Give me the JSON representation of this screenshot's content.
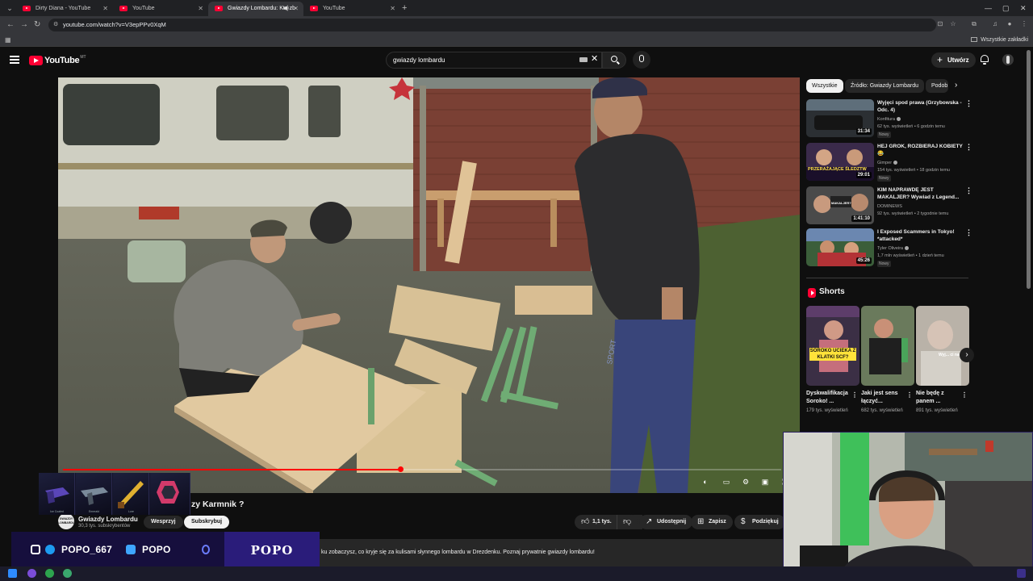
{
  "browser": {
    "tabs": [
      {
        "title": "Dirty Diana - YouTube",
        "active": false
      },
      {
        "title": "YouTube",
        "active": false
      },
      {
        "title": "Gwiazdy Lombardu: Kto zb",
        "active": true
      },
      {
        "title": "YouTube",
        "active": false
      }
    ],
    "url": "youtube.com/watch?v=V3epPPv0XqM",
    "all_bookmarks_label": "Wszystkie zakładki"
  },
  "youtube": {
    "logo_text": "YouTube",
    "country_code": "MT",
    "search_value": "gwiazdy lombardu",
    "create_label": "Utwórz"
  },
  "video": {
    "progress": 0.47,
    "title_visible": "zy Karmnik ?",
    "channel": {
      "name": "Gwiazdy Lombardu",
      "subscribers": "30,3 tys. subskrybentów",
      "avatar_text": "GWIAZDY LOMBARDU"
    },
    "join_label": "Wesprzyj",
    "subscribe_label": "Subskrybuj",
    "likes": "1,1 tys.",
    "share_label": "Udostępnij",
    "save_label": "Zapisz",
    "thanks_label": "Podziękuj",
    "description": "ku zobaczysz, co kryje się za kulisami słynnego lombardu w Drezdenku. Poznaj prywatnie gwiazdy lombardu!"
  },
  "sidebar": {
    "chips": [
      "Wszystkie",
      "Źródło: Gwiazdy Lombardu",
      "Podob"
    ],
    "recommendations": [
      {
        "title": "Wyjęci spod prawa (Grzybowska - Odc. 4)",
        "channel": "Konfitura",
        "meta": "62 tys. wyświetleń • 6 godzin temu",
        "badge": "Nowy",
        "duration": "31:34",
        "thumb_text": ""
      },
      {
        "title": "HEJ GROK, ROZBIERAJ KOBIETY 😂",
        "channel": "Gimper",
        "meta": "154 tys. wyświetleń • 18 godzin temu",
        "badge": "Nowy",
        "duration": "29:01",
        "thumb_text": "PRZERAŻAJĄCE ŚLEDZTW"
      },
      {
        "title": "KIM NAPRAWDĘ JEST MAKALJER? Wywiad z Legend...",
        "channel": "DOMINEWS",
        "meta": "92 tys. wyświetleń • 2 tygodnie temu",
        "badge": "",
        "duration": "1:41:10",
        "thumb_text": "MAKALJER?"
      },
      {
        "title": "I Exposed Scammers in Tokyo! *attacked*",
        "channel": "Tyler Oliveira",
        "meta": "1,7 mln wyświetleń • 1 dzień temu",
        "badge": "Nowy",
        "duration": "45:26",
        "thumb_text": ""
      }
    ],
    "shorts_title": "Shorts",
    "shorts": [
      {
        "title": "Dyskwalifikacja Soroko! ...",
        "views": "179 tys. wyświetleń",
        "thumb_text": "SOROKO UCIEKA Z KLATKI SCF?"
      },
      {
        "title": "Jaki jest sens łączyć...",
        "views": "682 tys. wyświetleń",
        "thumb_text": ""
      },
      {
        "title": "Nie będę z panem ...",
        "views": "891 tys. wyświetleń",
        "thumb_text": "Wyj... ci na łe"
      }
    ]
  },
  "overlay": {
    "skins": [
      "Ice Coaled",
      "Emerald",
      "Lore",
      ""
    ],
    "handle_1": "POPO_667",
    "handle_2": "POPO",
    "brand": "POPO"
  },
  "colors": {
    "accent": "#ff0033",
    "background": "#0f0f0f",
    "overlay": "#160f3d"
  }
}
